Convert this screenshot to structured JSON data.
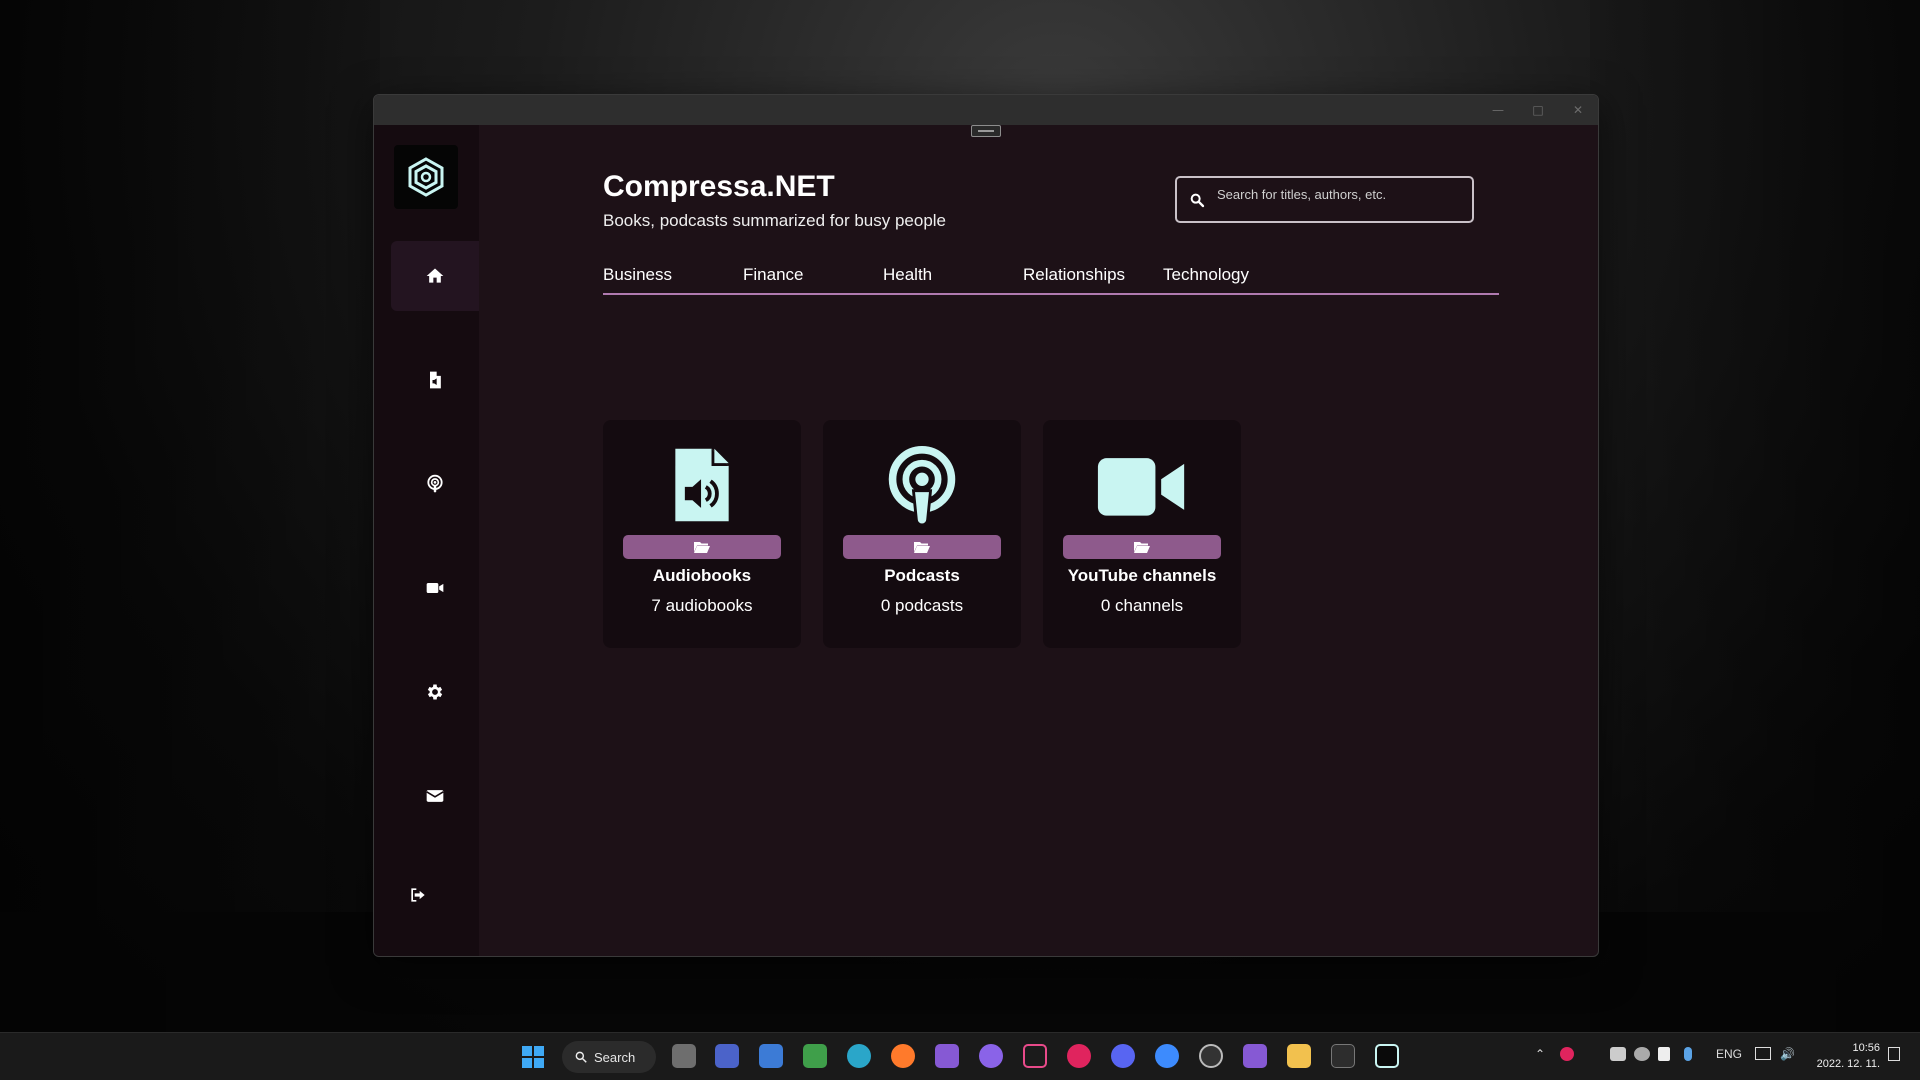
{
  "app": {
    "title": "Compressa.NET",
    "subtitle": "Books, podcasts summarized for busy people"
  },
  "search": {
    "placeholder": "Search for titles, authors, etc."
  },
  "sidebar": {
    "items": [
      {
        "name": "home",
        "icon": "home-icon",
        "active": true
      },
      {
        "name": "audiobooks",
        "icon": "audio-file-icon"
      },
      {
        "name": "podcasts",
        "icon": "podcast-icon"
      },
      {
        "name": "videos",
        "icon": "video-camera-icon"
      },
      {
        "name": "settings",
        "icon": "gear-icon"
      },
      {
        "name": "messages",
        "icon": "envelope-icon"
      },
      {
        "name": "logout",
        "icon": "sign-out-icon"
      }
    ]
  },
  "tabs": [
    {
      "label": "Business"
    },
    {
      "label": "Finance"
    },
    {
      "label": "Health"
    },
    {
      "label": "Relationships"
    },
    {
      "label": "Technology"
    }
  ],
  "cards": [
    {
      "title": "Audiobooks",
      "count": "7 audiobooks",
      "icon": "audio-file-icon"
    },
    {
      "title": "Podcasts",
      "count": "0 podcasts",
      "icon": "podcast-icon"
    },
    {
      "title": "YouTube channels",
      "count": "0 channels",
      "icon": "video-camera-icon"
    }
  ],
  "taskbar": {
    "search_label": "Search",
    "language": "ENG",
    "time": "10:56",
    "date": "2022. 12. 11."
  },
  "colors": {
    "accent": "#8e5a8c",
    "tab_underline": "#b07ab0",
    "icon_mint": "#c9f5f2",
    "window_bg": "#1d1117",
    "sidebar_bg": "#150b10"
  }
}
